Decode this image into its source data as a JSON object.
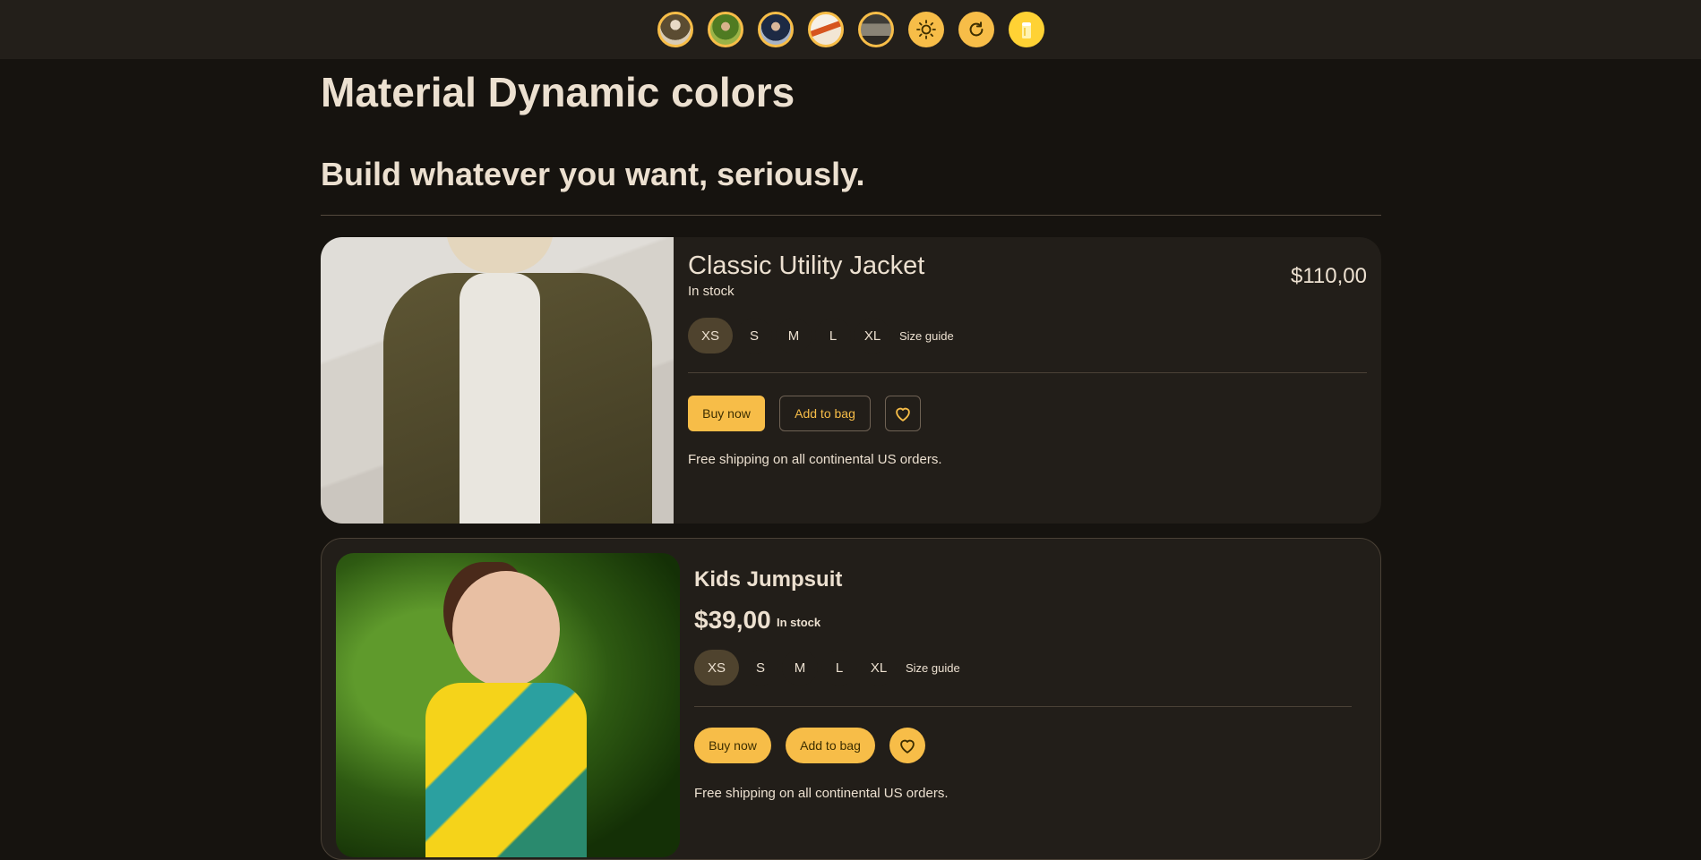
{
  "topbar": {
    "avatars": [
      {
        "name": "avatar-jacket"
      },
      {
        "name": "avatar-kid"
      },
      {
        "name": "avatar-suit"
      },
      {
        "name": "avatar-food"
      },
      {
        "name": "avatar-building"
      }
    ],
    "icons": [
      "sun-icon",
      "refresh-icon",
      "beer-icon"
    ]
  },
  "header": {
    "title": "Material Dynamic colors",
    "subtitle": "Build whatever you want, seriously."
  },
  "products": [
    {
      "name": "Classic Utility Jacket",
      "stock": "In stock",
      "price": "$110,00",
      "sizes": [
        "XS",
        "S",
        "M",
        "L",
        "XL"
      ],
      "selected_size": "XS",
      "size_guide": "Size guide",
      "buy_label": "Buy now",
      "bag_label": "Add to bag",
      "shipping": "Free shipping on all continental US orders."
    },
    {
      "name": "Kids Jumpsuit",
      "stock": "In stock",
      "price": "$39,00",
      "sizes": [
        "XS",
        "S",
        "M",
        "L",
        "XL"
      ],
      "selected_size": "XS",
      "size_guide": "Size guide",
      "buy_label": "Buy now",
      "bag_label": "Add to bag",
      "shipping": "Free shipping on all continental US orders."
    }
  ],
  "colors": {
    "background": "#16130f",
    "surface": "#221e19",
    "primary": "#f7bd48",
    "on_primary": "#3d2e00",
    "selected_chip": "#4f432e",
    "text": "#ece0d0"
  }
}
